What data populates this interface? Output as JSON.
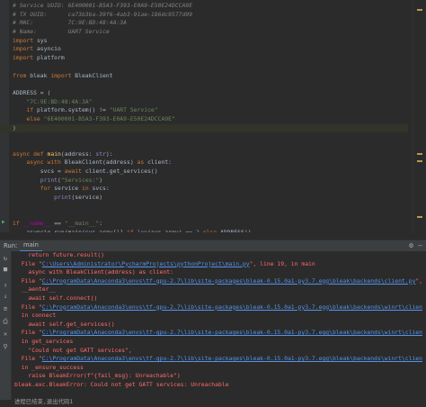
{
  "editor": {
    "lines": [
      {
        "parts": [
          {
            "c": "com",
            "t": "# Service UUID: 6E400001-B5A3-F393-E0A9-E50E24DCCA9E"
          }
        ]
      },
      {
        "parts": [
          {
            "c": "com",
            "t": "# TX UUID:      ca73b3ba-39f6-4ab3-91ae-186dc9577d99"
          }
        ]
      },
      {
        "parts": [
          {
            "c": "com",
            "t": "# MAC:          7C:9E:BD:48:4A:3A"
          }
        ]
      },
      {
        "parts": [
          {
            "c": "com",
            "t": "# Name:         UART Service"
          }
        ]
      },
      {
        "parts": [
          {
            "c": "kw",
            "t": "import"
          },
          {
            "c": "",
            "t": " sys"
          }
        ]
      },
      {
        "parts": [
          {
            "c": "kw",
            "t": "import"
          },
          {
            "c": "",
            "t": " asyncio"
          }
        ]
      },
      {
        "parts": [
          {
            "c": "kw",
            "t": "import"
          },
          {
            "c": "",
            "t": " platform"
          }
        ]
      },
      {
        "parts": [
          {
            "c": "",
            "t": ""
          }
        ]
      },
      {
        "parts": [
          {
            "c": "kw",
            "t": "from"
          },
          {
            "c": "",
            "t": " bleak "
          },
          {
            "c": "kw",
            "t": "import"
          },
          {
            "c": "",
            "t": " BleakClient"
          }
        ]
      },
      {
        "parts": [
          {
            "c": "",
            "t": ""
          }
        ]
      },
      {
        "parts": [
          {
            "c": "",
            "t": "ADDRESS = ("
          }
        ]
      },
      {
        "parts": [
          {
            "c": "",
            "t": "    "
          },
          {
            "c": "str",
            "t": "\"7C:9E:BD:48:4A:3A\""
          }
        ]
      },
      {
        "parts": [
          {
            "c": "",
            "t": "    "
          },
          {
            "c": "kw",
            "t": "if"
          },
          {
            "c": "",
            "t": " platform.system() != "
          },
          {
            "c": "str",
            "t": "\"UART Service\""
          }
        ]
      },
      {
        "parts": [
          {
            "c": "",
            "t": "    "
          },
          {
            "c": "kw",
            "t": "else"
          },
          {
            "c": "",
            "t": " "
          },
          {
            "c": "str",
            "t": "\"6E400001-B5A3-F393-E0A9-E50E24DCCA9E\""
          }
        ]
      },
      {
        "parts": [
          {
            "c": "",
            "t": ")"
          }
        ],
        "hl": true
      },
      {
        "parts": [
          {
            "c": "",
            "t": ""
          }
        ]
      },
      {
        "parts": [
          {
            "c": "",
            "t": ""
          }
        ]
      },
      {
        "parts": [
          {
            "c": "kw",
            "t": "async def"
          },
          {
            "c": "",
            "t": " "
          },
          {
            "c": "fn",
            "t": "main"
          },
          {
            "c": "",
            "t": "(address: "
          },
          {
            "c": "bi",
            "t": "str"
          },
          {
            "c": "",
            "t": "):"
          }
        ]
      },
      {
        "parts": [
          {
            "c": "",
            "t": "    "
          },
          {
            "c": "kw",
            "t": "async with"
          },
          {
            "c": "",
            "t": " BleakClient(address) "
          },
          {
            "c": "kw",
            "t": "as"
          },
          {
            "c": "",
            "t": " client:"
          }
        ]
      },
      {
        "parts": [
          {
            "c": "",
            "t": "        svcs = "
          },
          {
            "c": "kw",
            "t": "await"
          },
          {
            "c": "",
            "t": " client.get_services()"
          }
        ]
      },
      {
        "parts": [
          {
            "c": "",
            "t": "        "
          },
          {
            "c": "bi",
            "t": "print"
          },
          {
            "c": "",
            "t": "("
          },
          {
            "c": "str",
            "t": "\"Services:\""
          },
          {
            "c": "",
            "t": ")"
          }
        ]
      },
      {
        "parts": [
          {
            "c": "",
            "t": "        "
          },
          {
            "c": "kw",
            "t": "for"
          },
          {
            "c": "",
            "t": " service "
          },
          {
            "c": "kw",
            "t": "in"
          },
          {
            "c": "",
            "t": " svcs:"
          }
        ]
      },
      {
        "parts": [
          {
            "c": "",
            "t": "            "
          },
          {
            "c": "bi",
            "t": "print"
          },
          {
            "c": "",
            "t": "(service)"
          }
        ]
      },
      {
        "parts": [
          {
            "c": "",
            "t": ""
          }
        ]
      },
      {
        "parts": [
          {
            "c": "",
            "t": ""
          }
        ]
      },
      {
        "parts": [
          {
            "c": "kw",
            "t": "if"
          },
          {
            "c": "",
            "t": " "
          },
          {
            "c": "dnd",
            "t": "__name__"
          },
          {
            "c": "",
            "t": " == "
          },
          {
            "c": "str",
            "t": "\"__main__\""
          },
          {
            "c": "",
            "t": ":"
          }
        ]
      },
      {
        "parts": [
          {
            "c": "",
            "t": "    asyncio.run(main(sys.argv["
          },
          {
            "c": "num",
            "t": "1"
          },
          {
            "c": "",
            "t": "] "
          },
          {
            "c": "kw",
            "t": "if"
          },
          {
            "c": "",
            "t": " "
          },
          {
            "c": "bi",
            "t": "len"
          },
          {
            "c": "",
            "t": "(sys.argv) == "
          },
          {
            "c": "num",
            "t": "2"
          },
          {
            "c": "",
            "t": " "
          },
          {
            "c": "kw",
            "t": "else"
          },
          {
            "c": "",
            "t": " ADDRESS))"
          }
        ]
      }
    ]
  },
  "runbar": {
    "label": "Run:",
    "tab": "main"
  },
  "console": {
    "lines": [
      {
        "parts": [
          {
            "c": "err",
            "t": "    return future.result()"
          }
        ]
      },
      {
        "parts": [
          {
            "c": "err",
            "t": "  File \""
          },
          {
            "c": "link",
            "t": "C:\\Users\\Administrator\\PycharmProjects\\pythonProject\\main.py"
          },
          {
            "c": "err",
            "t": "\", line 19, in main"
          }
        ]
      },
      {
        "parts": [
          {
            "c": "err",
            "t": "    async with BleakClient(address) as client:"
          }
        ]
      },
      {
        "parts": [
          {
            "c": "err",
            "t": "  File \""
          },
          {
            "c": "link",
            "t": "C:\\ProgramData\\Anaconda3\\envs\\tf-gpu-2.7\\lib\\site-packages\\bleak-0.15.0a1-py3.7.egg\\bleak\\backends\\client.py"
          },
          {
            "c": "err",
            "t": "\", line 61, in"
          }
        ]
      },
      {
        "parts": [
          {
            "c": "err",
            "t": "  __aenter__"
          }
        ]
      },
      {
        "parts": [
          {
            "c": "err",
            "t": "    await self.connect()"
          }
        ]
      },
      {
        "parts": [
          {
            "c": "err",
            "t": "  File \""
          },
          {
            "c": "link",
            "t": "C:\\ProgramData\\Anaconda3\\envs\\tf-gpu-2.7\\lib\\site-packages\\bleak-0.15.0a1-py3.7.egg\\bleak\\backends\\winrt\\client.py"
          },
          {
            "c": "err",
            "t": "\", line 276,"
          }
        ]
      },
      {
        "parts": [
          {
            "c": "err",
            "t": "  in connect"
          }
        ]
      },
      {
        "parts": [
          {
            "c": "err",
            "t": "    await self.get_services()"
          }
        ]
      },
      {
        "parts": [
          {
            "c": "err",
            "t": "  File \""
          },
          {
            "c": "link",
            "t": "C:\\ProgramData\\Anaconda3\\envs\\tf-gpu-2.7\\lib\\site-packages\\bleak-0.15.0a1-py3.7.egg\\bleak\\backends\\winrt\\client.py"
          },
          {
            "c": "err",
            "t": "\", line 456,"
          }
        ]
      },
      {
        "parts": [
          {
            "c": "err",
            "t": "  in get_services"
          }
        ]
      },
      {
        "parts": [
          {
            "c": "err",
            "t": "    \"Could not get GATT services\","
          }
        ]
      },
      {
        "parts": [
          {
            "c": "err",
            "t": "  File \""
          },
          {
            "c": "link",
            "t": "C:\\ProgramData\\Anaconda3\\envs\\tf-gpu-2.7\\lib\\site-packages\\bleak-0.15.0a1-py3.7.egg\\bleak\\backends\\winrt\\client.py"
          },
          {
            "c": "err",
            "t": "\", line 105,"
          }
        ]
      },
      {
        "parts": [
          {
            "c": "err",
            "t": "  in _ensure_success"
          }
        ]
      },
      {
        "parts": [
          {
            "c": "err",
            "t": "    raise BleakError(f\"{fail_msg}: Unreachable\")"
          }
        ]
      },
      {
        "parts": [
          {
            "c": "err",
            "t": "bleak.exc.BleakError: Could not get GATT services: Unreachable"
          }
        ]
      },
      {
        "parts": [
          {
            "c": "",
            "t": ""
          }
        ]
      },
      {
        "parts": [
          {
            "c": "dim",
            "t": "进程已结束,退出代码1"
          }
        ]
      }
    ]
  },
  "icons": {
    "run": "run-triangle-icon",
    "gear": "gear-icon",
    "minimize": "minimize-icon"
  },
  "colors": {
    "background": "#2b2b2b",
    "keyword": "#cc7832",
    "string": "#6a8759",
    "comment": "#808080",
    "error": "#ff6b68",
    "link": "#5394ec"
  }
}
